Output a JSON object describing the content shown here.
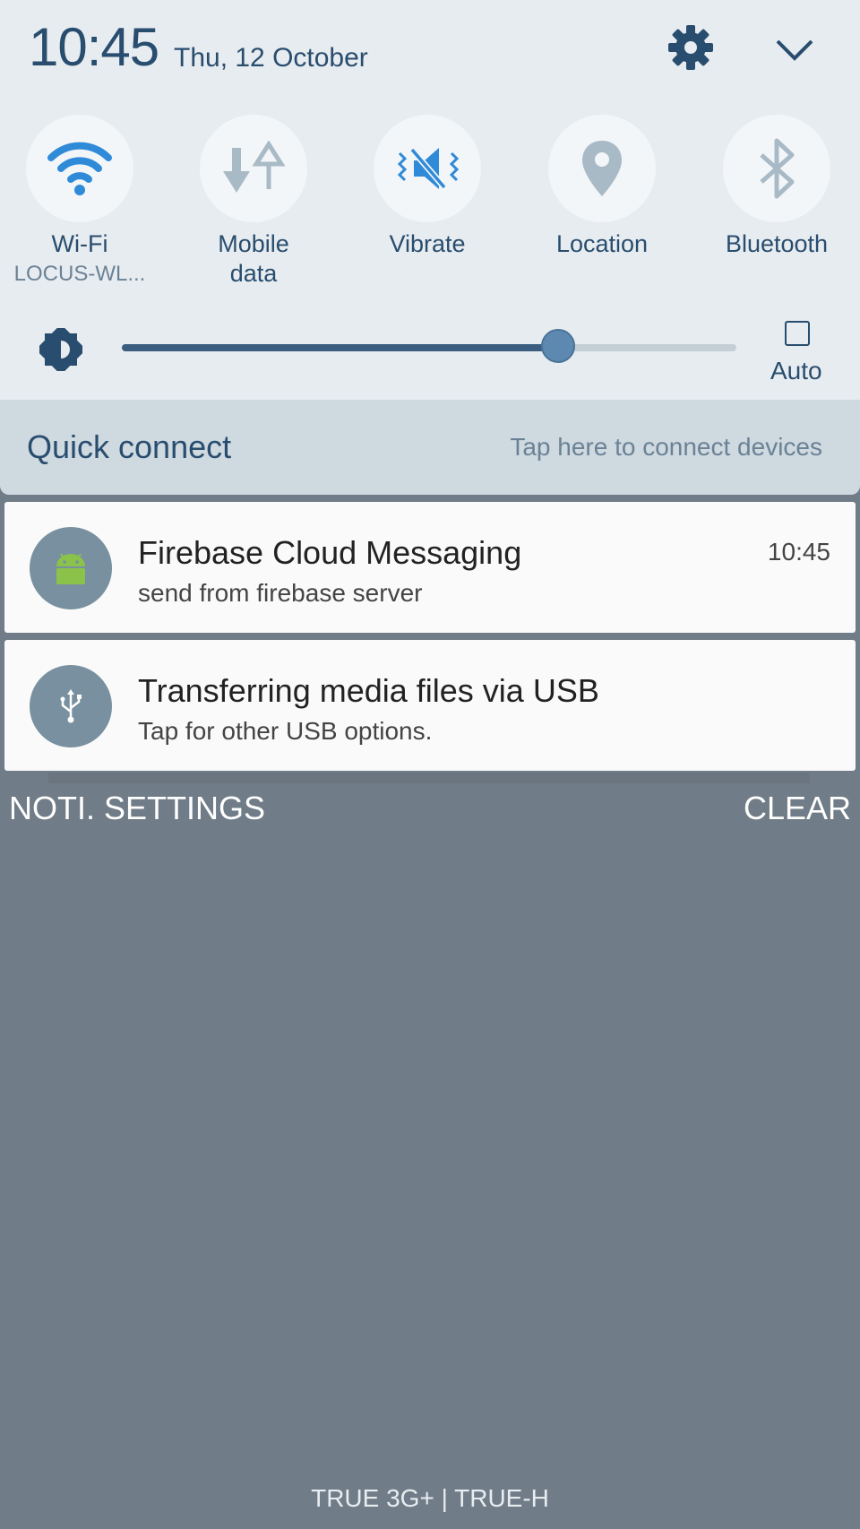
{
  "status": {
    "time": "10:45",
    "date": "Thu, 12 October",
    "settings_icon": "gear-icon",
    "collapse_icon": "chevron-down-icon"
  },
  "quick_toggles": [
    {
      "label": "Wi-Fi",
      "sublabel": "LOCUS-WL...",
      "icon": "wifi-icon",
      "active": true
    },
    {
      "label": "Mobile\ndata",
      "icon": "mobile-data-icon",
      "active": false
    },
    {
      "label": "Vibrate",
      "icon": "vibrate-icon",
      "active": true
    },
    {
      "label": "Location",
      "icon": "location-pin-icon",
      "active": false
    },
    {
      "label": "Bluetooth",
      "icon": "bluetooth-icon",
      "active": false
    }
  ],
  "brightness": {
    "icon": "brightness-icon",
    "level": 0.71,
    "auto_label": "Auto",
    "auto_checked": false
  },
  "quick_connect": {
    "title": "Quick connect",
    "hint": "Tap here to connect devices"
  },
  "notifications": [
    {
      "title": "Firebase Cloud Messaging",
      "body": "send from firebase server",
      "time": "10:45",
      "icon": "android-icon"
    },
    {
      "title": "Transferring media files via USB",
      "body": "Tap for other USB options.",
      "time": "",
      "icon": "usb-icon"
    }
  ],
  "actions": {
    "settings_label": "NOTI. SETTINGS",
    "clear_label": "CLEAR"
  },
  "carrier": "TRUE 3G+ | TRUE-H",
  "colors": {
    "accent": "#2f8ad8",
    "text_primary": "#294d6e",
    "inactive_icon": "#a9bac7",
    "backdrop": "#707c87"
  }
}
